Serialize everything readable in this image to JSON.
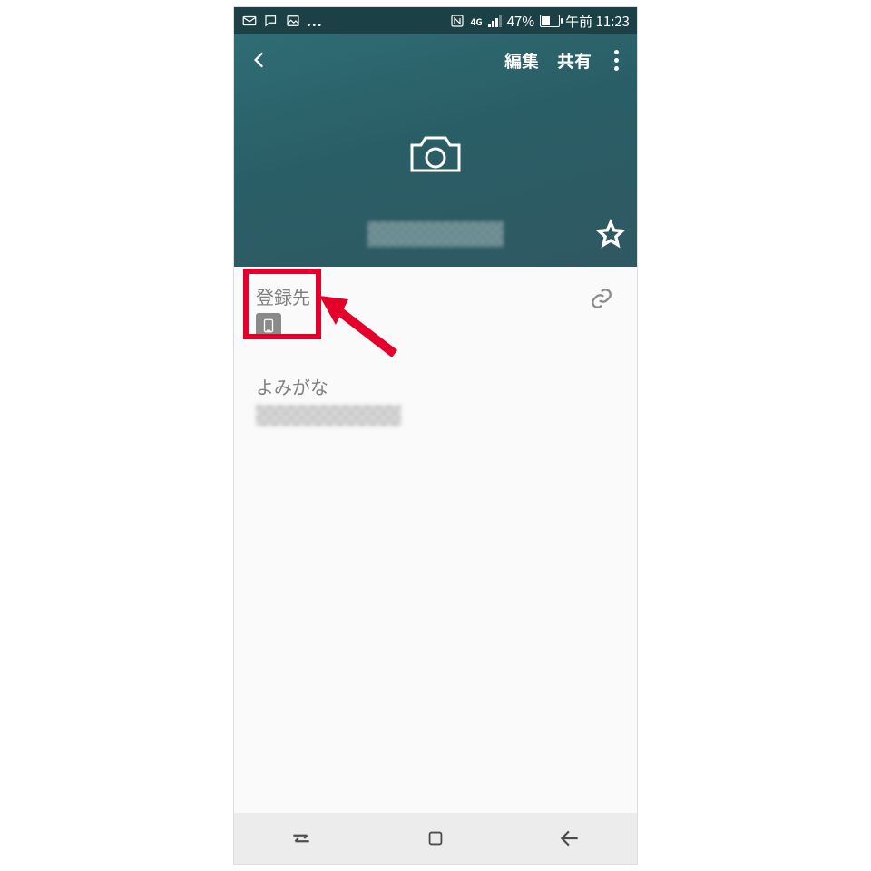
{
  "status": {
    "battery_pct": "47%",
    "net_label": "4G",
    "clock": "午前 11:23",
    "left_ellipsis": "..."
  },
  "actions": {
    "edit": "編集",
    "share": "共有"
  },
  "sections": {
    "registered_to": "登録先",
    "phonetic": "よみがな"
  },
  "annotation": {
    "highlight_target": "registered-to-device-icon"
  }
}
